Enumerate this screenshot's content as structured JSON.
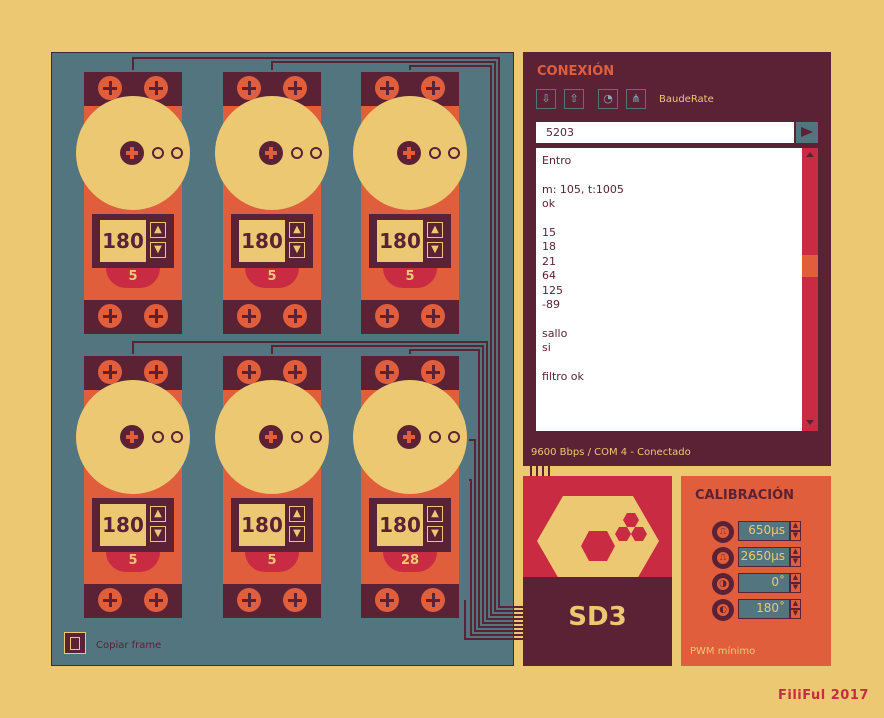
{
  "servos": [
    {
      "value": "180",
      "channel": "5"
    },
    {
      "value": "180",
      "channel": "5"
    },
    {
      "value": "180",
      "channel": "5"
    },
    {
      "value": "180",
      "channel": "5"
    },
    {
      "value": "180",
      "channel": "5"
    },
    {
      "value": "180",
      "channel": "28"
    }
  ],
  "servo_controls": {
    "up_icon": "chevron-up-icon",
    "down_icon": "chevron-down-icon"
  },
  "copy_frame": {
    "label": "Copiar frame",
    "icon": "clipboard-icon"
  },
  "connection": {
    "title": "CONEXIÓN",
    "toolbar_icons": [
      "usb-connect-icon",
      "usb-disconnect-icon",
      "gauge-icon",
      "network-icon"
    ],
    "baudrate_label": "BaudeRate",
    "input_value": "5203",
    "send_icon": "send-icon",
    "console_lines": [
      "Entro",
      "",
      "m: 105, t:1005",
      "ok",
      "",
      "15",
      "18",
      "21",
      "64",
      "125",
      "-89",
      "",
      "sallo",
      "si",
      "",
      "filtro ok"
    ],
    "status": "9600 Bbps / COM 4 - Conectado"
  },
  "logo": {
    "text": "SD3"
  },
  "calibration": {
    "title": "CALIBRACIÓN",
    "fields": [
      {
        "icon": "pulse-min-icon",
        "value": "650µs"
      },
      {
        "icon": "pulse-max-icon",
        "value": "2650µs"
      },
      {
        "icon": "angle-min-icon",
        "value": "0˚"
      },
      {
        "icon": "angle-max-icon",
        "value": "180˚"
      }
    ],
    "footer": "PWM mínimo"
  },
  "credit": {
    "name": "FiliFul",
    "year": "2017"
  },
  "colors": {
    "background": "#EDC873",
    "panel": "#537580",
    "dark": "#5B2236",
    "orange": "#E15E3D",
    "red": "#C92B43",
    "yellow": "#EDC873"
  }
}
